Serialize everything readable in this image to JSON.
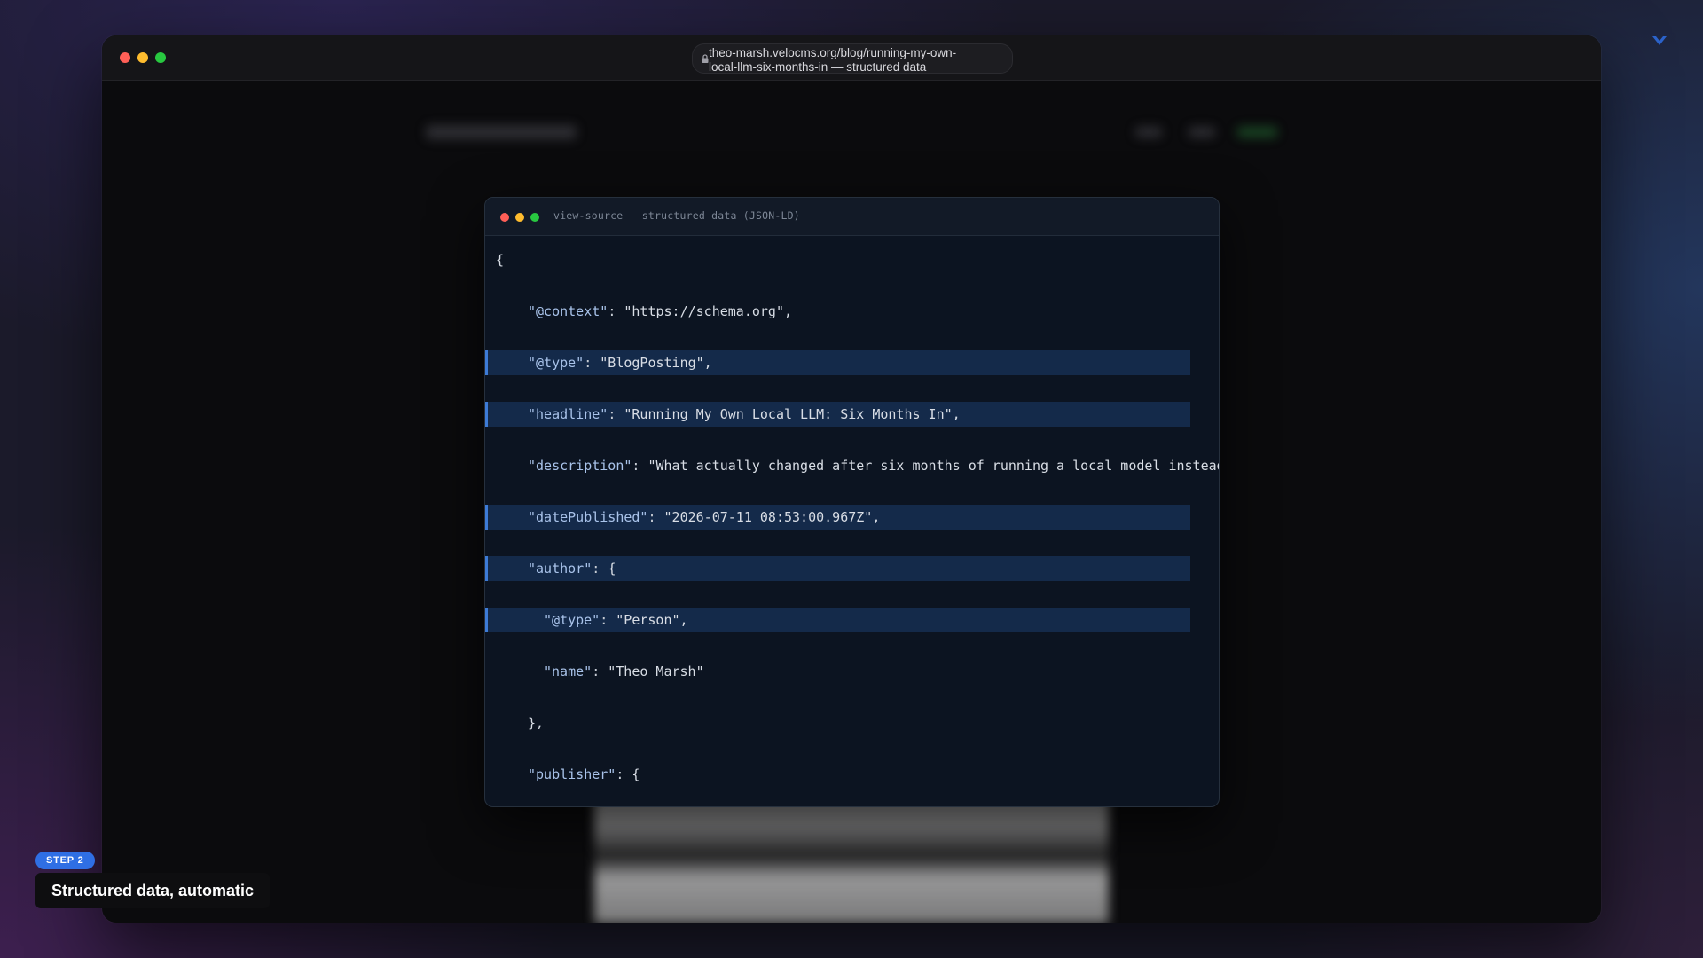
{
  "colors": {
    "accent": "#2f6fe4",
    "highlight": "#142a4a",
    "traffic_red": "#ff5f57",
    "traffic_yellow": "#febc2e",
    "traffic_green": "#28c840"
  },
  "browser": {
    "url_line1": "theo-marsh.velocms.org/blog/running-my-own-",
    "url_line2": "local-llm-six-months-in — structured data",
    "lock_icon": "lock-icon"
  },
  "code_window": {
    "title": "view-source — structured data (JSON-LD)",
    "lines": [
      {
        "indent": 0,
        "key": "",
        "value": "{",
        "highlighted": false
      },
      {
        "indent": 1,
        "key": "\"@context\"",
        "sep": ": ",
        "value": "\"https://schema.org\",",
        "highlighted": false
      },
      {
        "indent": 1,
        "key": "\"@type\"",
        "sep": ": ",
        "value": "\"BlogPosting\",",
        "highlighted": true
      },
      {
        "indent": 1,
        "key": "\"headline\"",
        "sep": ": ",
        "value": "\"Running My Own Local LLM: Six Months In\",",
        "highlighted": true
      },
      {
        "indent": 1,
        "key": "\"description\"",
        "sep": ": ",
        "value": "\"What actually changed after six months of running a local model instead",
        "highlighted": false
      },
      {
        "indent": 1,
        "key": "\"datePublished\"",
        "sep": ": ",
        "value": "\"2026-07-11 08:53:00.967Z\",",
        "highlighted": true
      },
      {
        "indent": 1,
        "key": "\"author\"",
        "sep": ": ",
        "value": "{",
        "highlighted": true
      },
      {
        "indent": 2,
        "key": "\"@type\"",
        "sep": ": ",
        "value": "\"Person\",",
        "highlighted": true
      },
      {
        "indent": 2,
        "key": "\"name\"",
        "sep": ": ",
        "value": "\"Theo Marsh\"",
        "highlighted": false
      },
      {
        "indent": 1,
        "key": "",
        "value": "},",
        "highlighted": false
      },
      {
        "indent": 1,
        "key": "\"publisher\"",
        "sep": ": ",
        "value": "{",
        "highlighted": false
      }
    ]
  },
  "step": {
    "badge": "STEP 2",
    "caption": "Structured data, automatic"
  },
  "corner_icon": "chevron-logo-icon"
}
